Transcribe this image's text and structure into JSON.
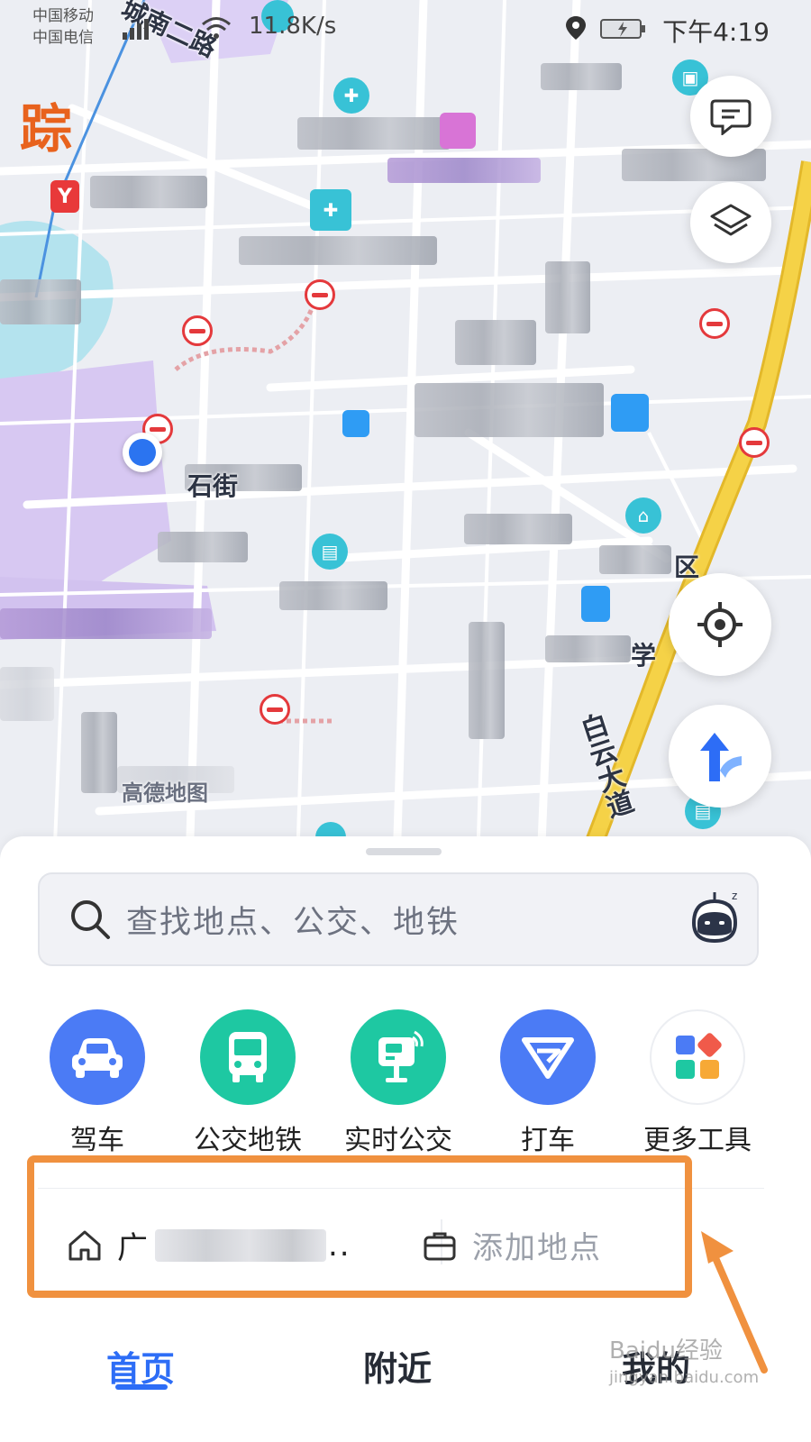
{
  "status_bar": {
    "carrier_1": "中国移动",
    "carrier_2": "中国电信",
    "net_speed": "11.8K/s",
    "time": "下午4:19"
  },
  "map": {
    "brand_mark": "踪",
    "metro_badge": "Y",
    "road_labels": {
      "top": "城南二路",
      "baiyun": "白云大道",
      "location_area": "石街",
      "district": "区",
      "school": "学",
      "bottom_left": "高德地图"
    }
  },
  "search": {
    "placeholder": "查找地点、公交、地铁"
  },
  "tools": [
    {
      "label": "驾车",
      "icon": "car-icon",
      "color": "#4b7bf5"
    },
    {
      "label": "公交地铁",
      "icon": "bus-icon",
      "color": "#1ec8a2"
    },
    {
      "label": "实时公交",
      "icon": "bus-stop-icon",
      "color": "#1ec8a2"
    },
    {
      "label": "打车",
      "icon": "taxi-icon",
      "color": "#4b7bf5"
    },
    {
      "label": "更多工具",
      "icon": "apps-grid-icon",
      "color": "#ffffff"
    }
  ],
  "places": {
    "home_prefix": "广",
    "home_ellipsis": "..",
    "work_label": "添加地点"
  },
  "tabs": [
    {
      "label": "首页",
      "active": true
    },
    {
      "label": "附近",
      "active": false
    },
    {
      "label": "我的",
      "active": false
    }
  ],
  "watermark": {
    "line1": "Baidu经验",
    "line2": "jingyan.baidu.com"
  },
  "colors": {
    "accent": "#2d6df6",
    "highlight_box": "#f0913f",
    "road_yellow": "#f5d247"
  }
}
